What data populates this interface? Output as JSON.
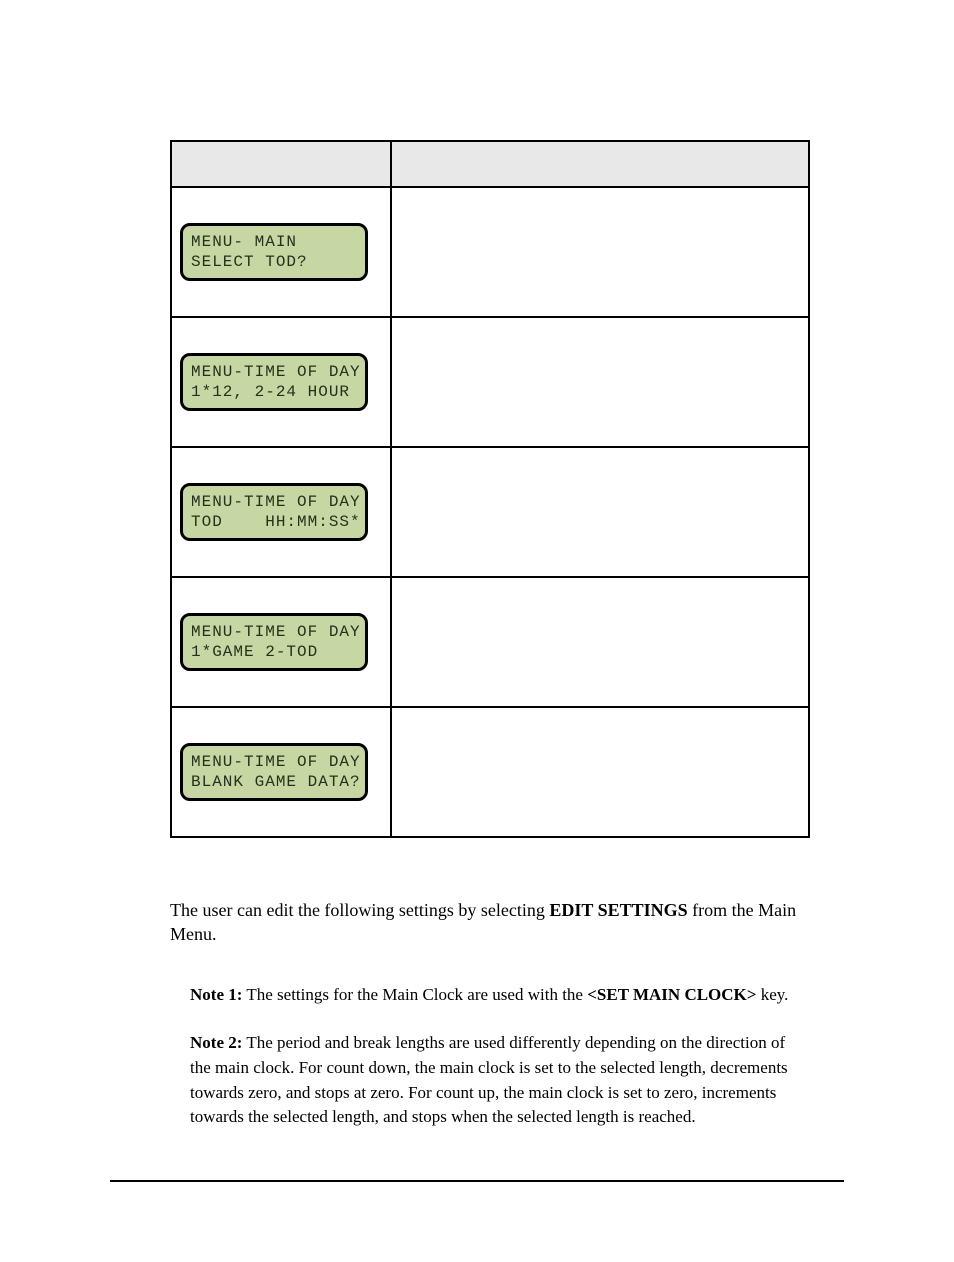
{
  "table": {
    "rows": [
      {
        "lcd": [
          "MENU- MAIN",
          "SELECT TOD?"
        ]
      },
      {
        "lcd": [
          "MENU-TIME OF DAY",
          "1*12, 2-24 HOUR"
        ]
      },
      {
        "lcd": [
          "MENU-TIME OF DAY",
          "TOD    HH:MM:SS*"
        ]
      },
      {
        "lcd": [
          "MENU-TIME OF DAY",
          "1*GAME 2-TOD"
        ]
      },
      {
        "lcd": [
          "MENU-TIME OF DAY",
          "BLANK GAME DATA?"
        ]
      }
    ]
  },
  "intro": {
    "prefix": "The user can edit the following settings by selecting ",
    "bold": "EDIT SETTINGS",
    "suffix": " from the Main Menu."
  },
  "notes": [
    {
      "label": "Note 1:",
      "prefix": " The settings for the Main Clock are used with the ",
      "bold": "<SET MAIN CLOCK>",
      "suffix": " key."
    },
    {
      "label": "Note 2:",
      "prefix": " The period and break lengths are used differently depending on the direction of the main clock. For count down, the main clock is set to the selected length, decrements towards zero, and stops at zero. For count up, the main clock is set to zero, increments towards the selected length, and stops when the selected length is reached.",
      "bold": "",
      "suffix": ""
    }
  ]
}
